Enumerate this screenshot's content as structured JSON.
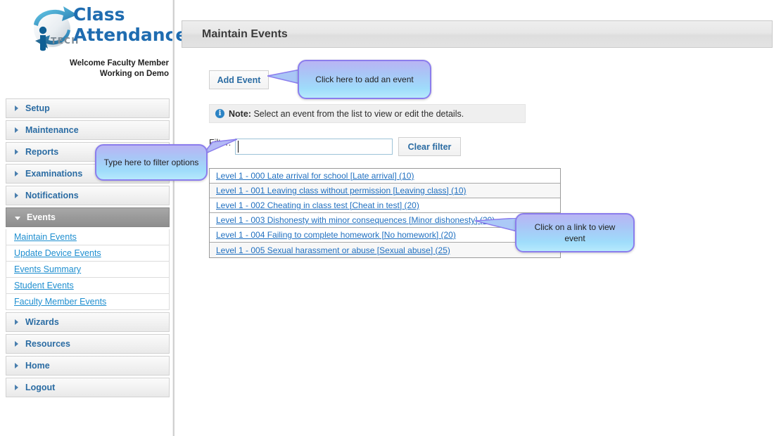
{
  "brand": {
    "logo_icon": "itech-globe-logo",
    "logo_text": "iTECH",
    "title_line1": "Class",
    "title_line2": "Attendance",
    "welcome_line1": "Welcome Faculty Member",
    "welcome_line2": "Working on Demo",
    "accent_color": "#1f6cb0"
  },
  "sidebar": {
    "groups": [
      {
        "label": "Setup",
        "icon": "chevron-right-icon",
        "expanded": false
      },
      {
        "label": "Maintenance",
        "icon": "chevron-right-icon",
        "expanded": false
      },
      {
        "label": "Reports",
        "icon": "chevron-right-icon",
        "expanded": false
      },
      {
        "label": "Examinations",
        "icon": "chevron-right-icon",
        "expanded": false
      },
      {
        "label": "Notifications",
        "icon": "chevron-right-icon",
        "expanded": false
      },
      {
        "label": "Events",
        "icon": "chevron-down-icon",
        "expanded": true
      },
      {
        "label": "Wizards",
        "icon": "chevron-right-icon",
        "expanded": false
      },
      {
        "label": "Resources",
        "icon": "chevron-right-icon",
        "expanded": false
      },
      {
        "label": "Home",
        "icon": "chevron-right-icon",
        "expanded": false
      },
      {
        "label": "Logout",
        "icon": "chevron-right-icon",
        "expanded": false
      }
    ],
    "events_subitems": [
      {
        "label": "Maintain Events"
      },
      {
        "label": "Update Device Events"
      },
      {
        "label": "Events Summary"
      },
      {
        "label": "Student Events"
      },
      {
        "label": "Faculty Member Events"
      }
    ],
    "link_color": "#1f8fd0",
    "active_bg": "#9a9a9a"
  },
  "header": {
    "title": "Maintain Events"
  },
  "main": {
    "add_event_label": "Add Event",
    "note_icon": "info-circle-icon",
    "note_prefix": "Note:",
    "note_text": "Select an event from the list to view or edit the details.",
    "filter_label": "Filter:",
    "filter_value": "",
    "filter_placeholder": "",
    "clear_filter_label": "Clear filter",
    "events": [
      {
        "label": "Level 1 - 000 Late arrival for school [Late arrival] (10)"
      },
      {
        "label": "Level 1 - 001 Leaving class without permission [Leaving class] (10)"
      },
      {
        "label": "Level 1 - 002 Cheating in class test [Cheat in test] (20)"
      },
      {
        "label": "Level 1 - 003 Dishonesty with minor consequences [Minor dishonesty] (20)"
      },
      {
        "label": "Level 1 - 004 Failing to complete homework [No homework] (20)"
      },
      {
        "label": "Level 1 - 005 Sexual harassment or abuse [Sexual abuse] (25)"
      }
    ]
  },
  "callouts": {
    "add_event": "Click here to add an event",
    "filter": "Type here to filter options",
    "view_event": "Click on a link to view event",
    "border_color": "#8b7ded",
    "fill_top": "#b9b4f4",
    "fill_bottom": "#b6e9fc"
  }
}
